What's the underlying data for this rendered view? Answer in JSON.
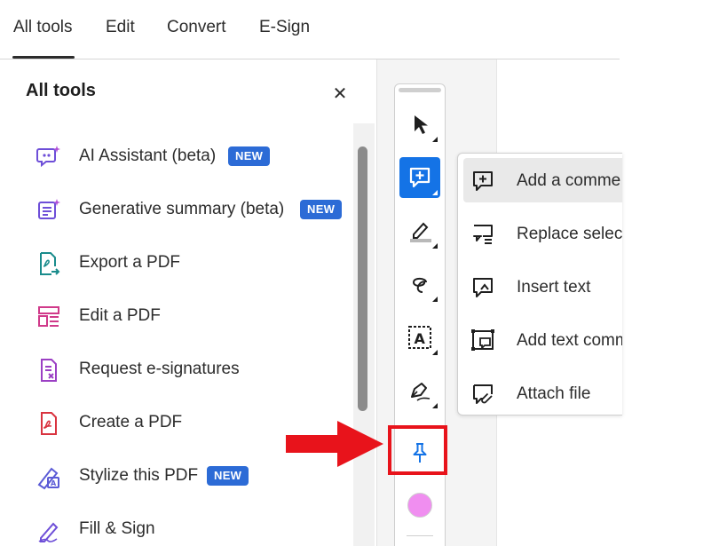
{
  "tabs": [
    {
      "label": "All tools",
      "active": true
    },
    {
      "label": "Edit",
      "active": false
    },
    {
      "label": "Convert",
      "active": false
    },
    {
      "label": "E-Sign",
      "active": false
    }
  ],
  "panel": {
    "title": "All tools",
    "close_icon": "close-icon",
    "items": [
      {
        "label": "AI Assistant (beta)",
        "badge": "NEW",
        "icon": "ai-assistant-icon"
      },
      {
        "label": "Generative summary (beta)",
        "badge": "NEW",
        "icon": "generative-summary-icon"
      },
      {
        "label": "Export a PDF",
        "badge": null,
        "icon": "export-pdf-icon"
      },
      {
        "label": "Edit a PDF",
        "badge": null,
        "icon": "edit-pdf-icon"
      },
      {
        "label": "Request e-signatures",
        "badge": null,
        "icon": "request-esignatures-icon"
      },
      {
        "label": "Create a PDF",
        "badge": null,
        "icon": "create-pdf-icon"
      },
      {
        "label": "Stylize this PDF",
        "badge": "NEW",
        "icon": "stylize-pdf-icon"
      },
      {
        "label": "Fill & Sign",
        "badge": null,
        "icon": "fill-sign-icon"
      }
    ]
  },
  "toolbar": {
    "tools": [
      {
        "name": "select-tool",
        "icon": "cursor-arrow-icon"
      },
      {
        "name": "comment-tool",
        "icon": "add-comment-icon",
        "active": true
      },
      {
        "name": "highlight-tool",
        "icon": "highlighter-icon"
      },
      {
        "name": "draw-tool",
        "icon": "freehand-draw-icon"
      },
      {
        "name": "text-tool",
        "icon": "text-box-icon"
      },
      {
        "name": "sign-tool",
        "icon": "pen-sign-icon"
      },
      {
        "name": "pin-tool",
        "icon": "pin-icon"
      }
    ],
    "color": "#f08ef0"
  },
  "popup_menu": {
    "items": [
      {
        "label": "Add a comme",
        "icon": "add-comment-icon",
        "selected": true
      },
      {
        "label": "Replace select",
        "icon": "replace-text-icon",
        "selected": false
      },
      {
        "label": "Insert text",
        "icon": "insert-text-icon",
        "selected": false
      },
      {
        "label": "Add text comm",
        "icon": "text-comment-icon",
        "selected": false
      },
      {
        "label": "Attach file",
        "icon": "attach-file-icon",
        "selected": false
      }
    ]
  },
  "colors": {
    "accent": "#1473e6",
    "badge": "#2c6bd6",
    "annotation_red": "#e8131b"
  }
}
